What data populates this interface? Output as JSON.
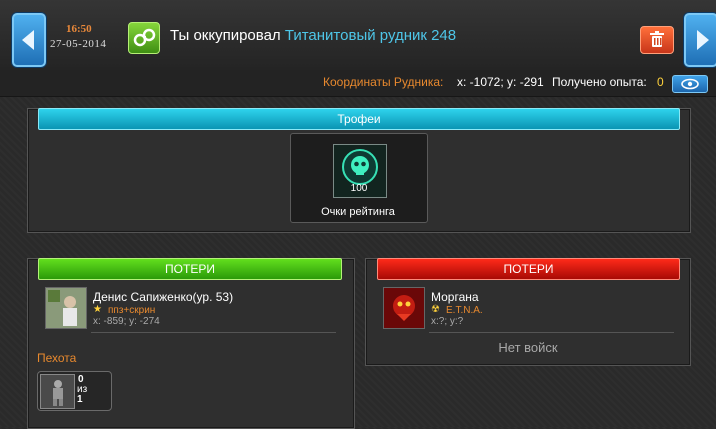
{
  "header": {
    "time": "16:50",
    "date": "27-05-2014",
    "headline_main": "Ты оккупировал",
    "headline_link": "Титанитовый рудник 248",
    "icons": {
      "back": "chevron-left-icon",
      "forward": "chevron-right-icon",
      "status": "handcuffs-icon",
      "delete": "trash-icon"
    }
  },
  "subbar": {
    "coords_label": "Координаты Рудника:",
    "coords_value": "x: -1072; y: -291",
    "xp_label": "Получено опыта:",
    "xp_value": "0",
    "view_icon": "eye-icon"
  },
  "trophies": {
    "title": "Трофеи",
    "items": [
      {
        "icon": "skull-icon",
        "value": "100",
        "label": "Очки рейтинга"
      }
    ]
  },
  "left_loss": {
    "title": "ПОТЕРИ",
    "player_name": "Денис Сапиженко(ур. 53)",
    "clan": "ппз+скрин",
    "coords": "x: -859; y: -274",
    "unit_type": "Пехота",
    "units": [
      {
        "top": "0",
        "mid": "из",
        "bottom": "1"
      }
    ]
  },
  "right_loss": {
    "title": "ПОТЕРИ",
    "player_name": "Моргана",
    "clan": "E.T.N.A.",
    "coords": "x:?; y:?",
    "no_troops": "Нет войск"
  },
  "colors": {
    "accent_orange": "#e8892e",
    "link_cyan": "#4ec6e8",
    "banner_cyan": "#0fb0cc",
    "banner_green": "#3fbd12",
    "banner_red": "#d8160c",
    "nav_blue": "#2a8cd6"
  }
}
